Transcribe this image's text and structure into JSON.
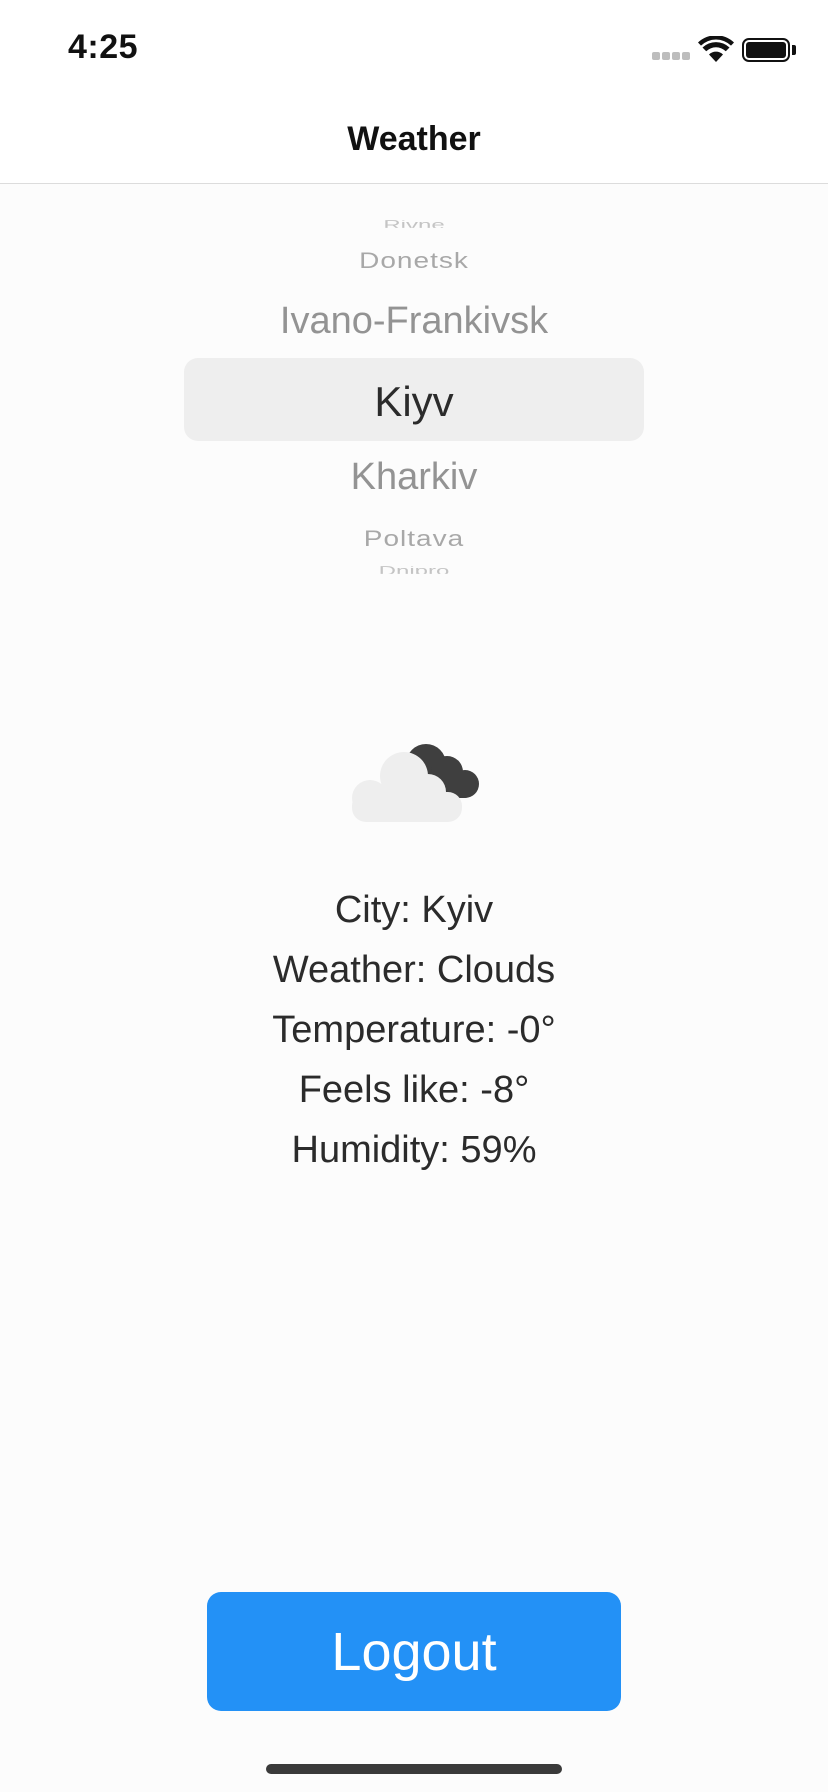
{
  "status_bar": {
    "time": "4:25"
  },
  "nav": {
    "title": "Weather"
  },
  "picker": {
    "items": [
      "Rivne",
      "Donetsk",
      "Ivano-Frankivsk",
      "Kiyv",
      "Kharkiv",
      "Poltava",
      "Dnipro"
    ],
    "selected": "Kiyv"
  },
  "weather": {
    "icon": "cloudy-icon",
    "city_line": "City: Kyiv",
    "weather_line": "Weather: Clouds",
    "temperature_line": "Temperature: -0°",
    "feels_like_line": "Feels like: -8°",
    "humidity_line": "Humidity: 59%"
  },
  "actions": {
    "logout_label": "Logout"
  },
  "colors": {
    "accent": "#2391f6",
    "background": "#fcfcfc",
    "picker_selection": "#eeeeee",
    "text": "#2b2b2b"
  }
}
